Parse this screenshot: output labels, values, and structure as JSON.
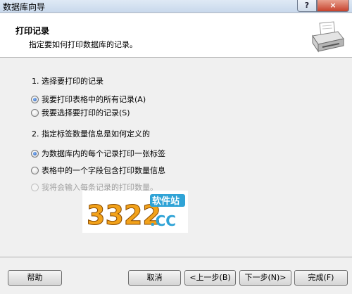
{
  "window": {
    "title": "数据库向导",
    "help_glyph": "?",
    "close_glyph": "×"
  },
  "header": {
    "title": "打印记录",
    "subtitle": "指定要如何打印数据库的记录。",
    "icon": "printer-icon"
  },
  "section1": {
    "label": "1. 选择要打印的记录",
    "options": [
      {
        "label": "我要打印表格中的所有记录(A)",
        "checked": true,
        "enabled": true
      },
      {
        "label": "我要选择要打印的记录(S)",
        "checked": false,
        "enabled": true
      }
    ]
  },
  "section2": {
    "label": "2. 指定标签数量信息是如何定义的",
    "options": [
      {
        "label": "为数据库内的每个记录打印一张标签",
        "checked": true,
        "enabled": true
      },
      {
        "label": "表格中的一个字段包含打印数量信息",
        "checked": false,
        "enabled": true
      },
      {
        "label": "我将会输入每条记录的打印数量。",
        "checked": false,
        "enabled": false
      }
    ]
  },
  "watermark": {
    "digits": "3322",
    "suffix": ".CC",
    "tag": "软件站"
  },
  "buttons": {
    "help": "帮助",
    "cancel": "取消",
    "back": "<上一步(B)",
    "next": "下一步(N)>",
    "finish": "完成(F)"
  }
}
